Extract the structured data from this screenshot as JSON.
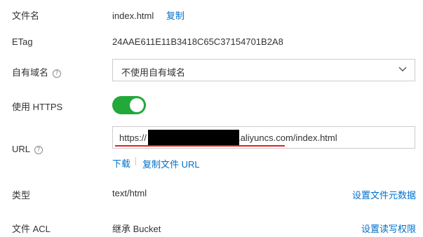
{
  "fields": {
    "filename": {
      "label": "文件名",
      "value": "index.html",
      "copy_label": "复制"
    },
    "etag": {
      "label": "ETag",
      "value": "24AAE611E11B3418C65C37154701B2A8"
    },
    "domain": {
      "label": "自有域名",
      "help_icon": "question-circle-icon",
      "selected": "不使用自有域名",
      "chevron_icon": "chevron-down-icon"
    },
    "https": {
      "label": "使用 HTTPS",
      "enabled": true,
      "color": "#23a83a"
    },
    "url": {
      "label": "URL",
      "help_icon": "question-circle-icon",
      "prefix": "https://",
      "suffix": ".aliyuncs.com/index.html",
      "download_label": "下载",
      "copy_url_label": "复制文件 URL",
      "underline_color": "#e02020"
    },
    "type": {
      "label": "类型",
      "value": "text/html",
      "action": "设置文件元数据"
    },
    "acl": {
      "label": "文件 ACL",
      "value": "继承 Bucket",
      "action": "设置读写权限"
    }
  },
  "colors": {
    "link": "#0070cc",
    "text": "#333333",
    "border": "#cccccc"
  }
}
